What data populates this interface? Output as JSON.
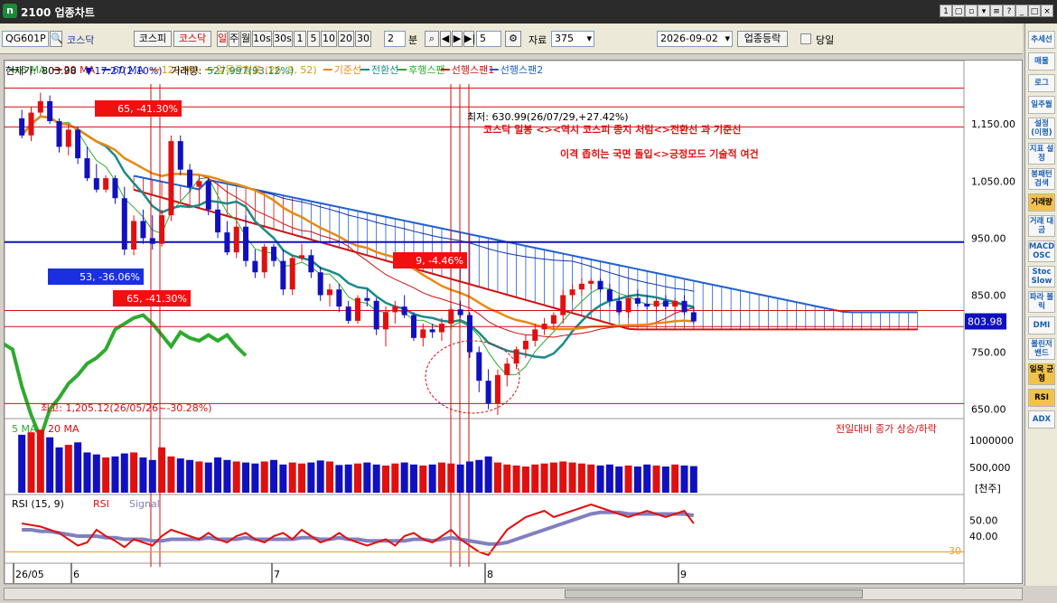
{
  "window": {
    "title": "2100 업종차트",
    "logo": "n",
    "controls": [
      "1",
      "▢",
      "▫",
      "▾",
      "≡",
      "?",
      "_",
      "□",
      "×"
    ]
  },
  "toolbar": {
    "code": "QG601P",
    "name": "코스닥",
    "market_tabs": [
      "코스피",
      "코스닥"
    ],
    "period_buttons": [
      "일",
      "주",
      "월",
      "10s",
      "30s",
      "1",
      "5",
      "10",
      "20",
      "30"
    ],
    "period_value": "2",
    "period_unit": "분",
    "count_value": "5",
    "data_label": "자료",
    "data_count": "375",
    "date": "2026-09-02",
    "sector_button": "업종등락",
    "today_label": "당일"
  },
  "info": {
    "price_label": "현재가:",
    "price": "803.98",
    "change_arrow": "▼",
    "change": "17.27(2.10%)",
    "volume_label": "거래량:",
    "volume": "527,997(93.12%)"
  },
  "legend": [
    {
      "label": "5 MA",
      "color": "#2eaa2e"
    },
    {
      "label": "20 MA",
      "color": "#d01010"
    },
    {
      "label": "60 MA",
      "color": "#1030b0"
    },
    {
      "label": "120 MA",
      "color": "#e8960a"
    },
    {
      "label": "일목균형표 (26, 9, 52)",
      "color": "#d0a000"
    },
    {
      "label": "기준선",
      "color": "#e88a10"
    },
    {
      "label": "전환선",
      "color": "#1a8a8a"
    },
    {
      "label": "후행스팬",
      "color": "#2eaa2e"
    },
    {
      "label": "선행스팬1",
      "color": "#d01010"
    },
    {
      "label": "선행스팬2",
      "color": "#2060c0"
    }
  ],
  "annotation": {
    "line1": "코스닥 일봉 <><역시 코스피 종지 처럼<>전환선 과 기준선",
    "line2": "이격 좁히는 국면 돌입<>긍정모드 기술적 여건"
  },
  "price_axis": {
    "ticks": [
      "1,150.00",
      "1,050.00",
      "950.00",
      "850.00",
      "750.00",
      "650.00"
    ],
    "current": "803.98"
  },
  "labels": {
    "high_label": "최고: 1,205.12(26/05/26~-30.28%)",
    "max_label": "최저: 630.99(26/07/29,+27.42%)",
    "box1": "65, -41.30%",
    "box2": "53, -36.06%",
    "box3": "65, -41.30%",
    "box4": "9, -4.46%"
  },
  "volume_panel": {
    "legend": [
      "5 MA",
      "20 MA"
    ],
    "title": "전일대비 종가 상승/하락",
    "ticks": [
      "1000000",
      "500,000"
    ],
    "unit": "[천주]"
  },
  "rsi_panel": {
    "legend": [
      "RSI (15, 9)",
      "RSI",
      "Signal"
    ],
    "ticks": [
      "50.00",
      "40.00"
    ],
    "level": "30"
  },
  "date_axis": [
    "26/05",
    "6",
    "7",
    "8",
    "9"
  ],
  "sidebar": [
    {
      "label": "추세선",
      "hl": false
    },
    {
      "label": "매물",
      "hl": false
    },
    {
      "label": "로그",
      "hl": false
    },
    {
      "label": "일주월",
      "hl": false
    },
    {
      "label": "설정 (이평)",
      "hl": false
    },
    {
      "label": "지표 설정",
      "hl": false
    },
    {
      "label": "봉패턴 검색",
      "hl": false
    },
    {
      "label": "거래량",
      "hl": true
    },
    {
      "label": "거래 대금",
      "hl": false
    },
    {
      "label": "MACD OSC",
      "hl": false
    },
    {
      "label": "Stoc Slow",
      "hl": false
    },
    {
      "label": "파라 볼릭",
      "hl": false
    },
    {
      "label": "DMI",
      "hl": false
    },
    {
      "label": "볼린저 밴드",
      "hl": false
    },
    {
      "label": "일목 균형",
      "hl": true
    },
    {
      "label": "RSI",
      "hl": true
    },
    {
      "label": "ADX",
      "hl": false
    }
  ],
  "colors": {
    "up": "#e01010",
    "down": "#1010c0",
    "cloud": "#2060d0",
    "kumo_red": "#d01010",
    "base": "#e88a10",
    "conv": "#1a8a8a",
    "lagging": "#2eaa2e"
  },
  "chart_data": {
    "type": "candlestick",
    "series_candles": [
      [
        1160,
        1175,
        1125,
        1130
      ],
      [
        1130,
        1180,
        1120,
        1170
      ],
      [
        1170,
        1205,
        1165,
        1190
      ],
      [
        1190,
        1200,
        1150,
        1155
      ],
      [
        1155,
        1160,
        1100,
        1110
      ],
      [
        1110,
        1150,
        1095,
        1140
      ],
      [
        1140,
        1145,
        1080,
        1090
      ],
      [
        1090,
        1110,
        1050,
        1055
      ],
      [
        1055,
        1080,
        1030,
        1035
      ],
      [
        1035,
        1060,
        1030,
        1055
      ],
      [
        1055,
        1060,
        1010,
        1020
      ],
      [
        1020,
        1040,
        920,
        930
      ],
      [
        930,
        990,
        920,
        980
      ],
      [
        980,
        1000,
        940,
        950
      ],
      [
        950,
        990,
        930,
        940
      ],
      [
        940,
        1000,
        935,
        990
      ],
      [
        990,
        1130,
        980,
        1120
      ],
      [
        1120,
        1130,
        1060,
        1070
      ],
      [
        1070,
        1080,
        1030,
        1040
      ],
      [
        1040,
        1060,
        1010,
        1050
      ],
      [
        1050,
        1055,
        990,
        1000
      ],
      [
        1000,
        1010,
        950,
        960
      ],
      [
        960,
        980,
        920,
        925
      ],
      [
        925,
        980,
        915,
        970
      ],
      [
        970,
        990,
        900,
        910
      ],
      [
        910,
        930,
        880,
        890
      ],
      [
        890,
        940,
        880,
        935
      ],
      [
        935,
        940,
        900,
        910
      ],
      [
        910,
        930,
        850,
        860
      ],
      [
        860,
        920,
        850,
        915
      ],
      [
        915,
        940,
        910,
        920
      ],
      [
        920,
        930,
        880,
        890
      ],
      [
        890,
        900,
        840,
        850
      ],
      [
        850,
        870,
        830,
        860
      ],
      [
        860,
        870,
        820,
        830
      ],
      [
        830,
        840,
        800,
        805
      ],
      [
        805,
        850,
        800,
        845
      ],
      [
        845,
        860,
        830,
        840
      ],
      [
        840,
        845,
        780,
        790
      ],
      [
        790,
        830,
        760,
        820
      ],
      [
        820,
        840,
        800,
        830
      ],
      [
        830,
        850,
        810,
        815
      ],
      [
        815,
        820,
        770,
        775
      ],
      [
        775,
        800,
        760,
        790
      ],
      [
        790,
        800,
        775,
        785
      ],
      [
        785,
        810,
        770,
        800
      ],
      [
        800,
        830,
        790,
        825
      ],
      [
        825,
        840,
        810,
        815
      ],
      [
        815,
        820,
        740,
        750
      ],
      [
        750,
        760,
        680,
        700
      ],
      [
        700,
        720,
        650,
        660
      ],
      [
        660,
        720,
        640,
        710
      ],
      [
        710,
        740,
        690,
        730
      ],
      [
        730,
        760,
        720,
        755
      ],
      [
        755,
        780,
        740,
        770
      ],
      [
        770,
        800,
        760,
        790
      ],
      [
        790,
        810,
        780,
        800
      ],
      [
        800,
        820,
        790,
        815
      ],
      [
        815,
        860,
        800,
        850
      ],
      [
        850,
        870,
        840,
        860
      ],
      [
        860,
        880,
        850,
        870
      ],
      [
        870,
        880,
        860,
        875
      ],
      [
        875,
        880,
        855,
        860
      ],
      [
        860,
        870,
        830,
        840
      ],
      [
        840,
        850,
        815,
        820
      ],
      [
        820,
        850,
        810,
        845
      ],
      [
        845,
        860,
        830,
        835
      ],
      [
        835,
        850,
        825,
        830
      ],
      [
        830,
        845,
        820,
        840
      ],
      [
        840,
        850,
        825,
        830
      ],
      [
        830,
        845,
        820,
        840
      ],
      [
        840,
        850,
        815,
        820
      ],
      [
        820,
        830,
        800,
        804
      ]
    ],
    "price_range": [
      640,
      1220
    ],
    "volume_values": [
      1150,
      1200,
      1250,
      1100,
      900,
      950,
      1000,
      800,
      760,
      700,
      720,
      780,
      800,
      700,
      650,
      900,
      720,
      680,
      650,
      620,
      600,
      700,
      650,
      620,
      600,
      580,
      620,
      650,
      560,
      600,
      580,
      600,
      640,
      620,
      550,
      560,
      580,
      600,
      560,
      540,
      580,
      600,
      560,
      540,
      560,
      600,
      580,
      560,
      620,
      650,
      720,
      600,
      560,
      540,
      520,
      560,
      580,
      600,
      620,
      600,
      580,
      560,
      540,
      560,
      520,
      540,
      520,
      560,
      540,
      520,
      560,
      540,
      528
    ],
    "rsi_values": [
      48,
      47,
      46,
      44,
      42,
      38,
      34,
      36,
      44,
      40,
      37,
      33,
      38,
      36,
      34,
      40,
      44,
      42,
      40,
      38,
      42,
      38,
      36,
      40,
      42,
      38,
      36,
      40,
      42,
      38,
      44,
      40,
      36,
      38,
      42,
      38,
      36,
      34,
      36,
      38,
      34,
      40,
      42,
      38,
      36,
      40,
      44,
      38,
      34,
      30,
      28,
      36,
      44,
      48,
      52,
      54,
      56,
      52,
      54,
      56,
      58,
      60,
      58,
      56,
      54,
      52,
      54,
      56,
      54,
      52,
      54,
      56,
      48
    ],
    "rsi_signal": [
      44,
      44,
      43,
      43,
      42,
      41,
      40,
      40,
      40,
      39,
      39,
      38,
      38,
      38,
      37,
      37,
      38,
      38,
      38,
      38,
      39,
      38,
      38,
      38,
      39,
      38,
      38,
      38,
      38,
      38,
      39,
      39,
      38,
      38,
      39,
      38,
      38,
      37,
      37,
      37,
      37,
      37,
      38,
      38,
      37,
      38,
      39,
      38,
      37,
      36,
      35,
      35,
      36,
      38,
      40,
      42,
      44,
      46,
      48,
      50,
      52,
      54,
      55,
      55,
      55,
      54,
      54,
      54,
      54,
      54,
      54,
      54,
      53
    ]
  }
}
